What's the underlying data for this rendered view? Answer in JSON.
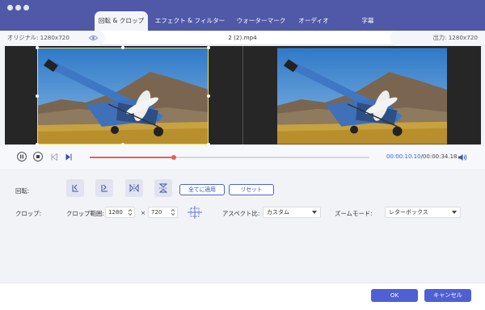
{
  "window": {
    "traffic_lights": [
      "close",
      "minimize",
      "zoom"
    ]
  },
  "tabs": [
    {
      "label": "回転 & クロップ",
      "active": true
    },
    {
      "label": "エフェクト & フィルター",
      "active": false
    },
    {
      "label": "ウォーターマーク",
      "active": false
    },
    {
      "label": "オーディオ",
      "active": false
    },
    {
      "label": "字幕",
      "active": false
    }
  ],
  "infobar": {
    "original": "オリジナル: 1280x720",
    "filename": "2 (2).mp4",
    "output": "出力: 1280x720"
  },
  "playback": {
    "progress": 0.3,
    "current_time": "00:00:10.10",
    "total_time": "/00:00:34.18"
  },
  "rotation": {
    "label": "回転:",
    "apply_all": "全てに適用",
    "reset": "リセット"
  },
  "crop": {
    "label": "クロップ:",
    "range_label": "クロップ範囲:",
    "width": "1280",
    "times": "×",
    "height": "720"
  },
  "aspect": {
    "label": "アスペクト比:",
    "value": "カスタム"
  },
  "zoom": {
    "label": "ズームモード:",
    "value": "レターボックス"
  },
  "footer": {
    "ok": "OK",
    "cancel": "キャンセル"
  },
  "colors": {
    "accent": "#4f59a8",
    "button": "#4f5fd4",
    "progress": "#ec5d55",
    "crop_frame": "#e8e26a"
  }
}
